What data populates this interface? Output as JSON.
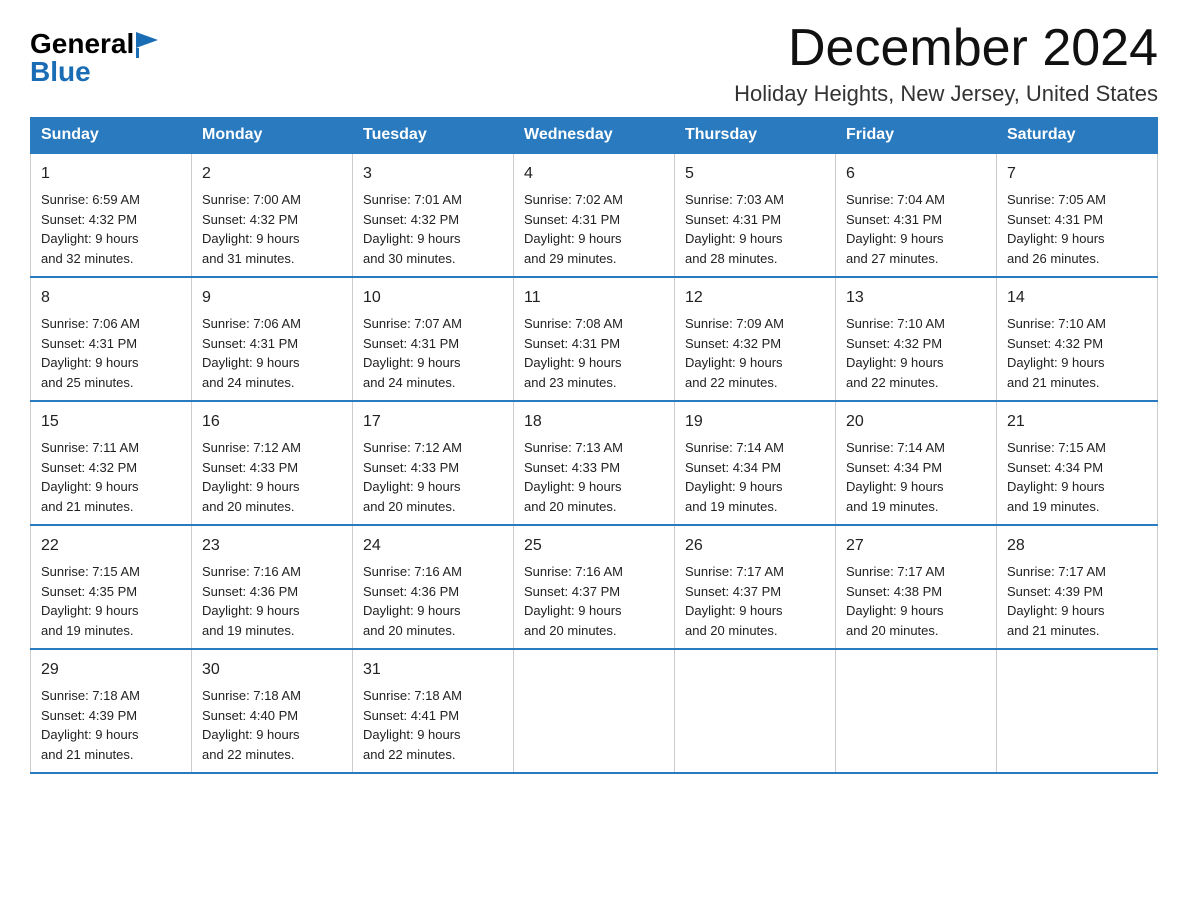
{
  "header": {
    "logo_general": "General",
    "logo_blue": "Blue",
    "month_title": "December 2024",
    "subtitle": "Holiday Heights, New Jersey, United States"
  },
  "weekdays": [
    "Sunday",
    "Monday",
    "Tuesday",
    "Wednesday",
    "Thursday",
    "Friday",
    "Saturday"
  ],
  "weeks": [
    [
      {
        "day": "1",
        "sunrise": "6:59 AM",
        "sunset": "4:32 PM",
        "daylight": "9 hours and 32 minutes."
      },
      {
        "day": "2",
        "sunrise": "7:00 AM",
        "sunset": "4:32 PM",
        "daylight": "9 hours and 31 minutes."
      },
      {
        "day": "3",
        "sunrise": "7:01 AM",
        "sunset": "4:32 PM",
        "daylight": "9 hours and 30 minutes."
      },
      {
        "day": "4",
        "sunrise": "7:02 AM",
        "sunset": "4:31 PM",
        "daylight": "9 hours and 29 minutes."
      },
      {
        "day": "5",
        "sunrise": "7:03 AM",
        "sunset": "4:31 PM",
        "daylight": "9 hours and 28 minutes."
      },
      {
        "day": "6",
        "sunrise": "7:04 AM",
        "sunset": "4:31 PM",
        "daylight": "9 hours and 27 minutes."
      },
      {
        "day": "7",
        "sunrise": "7:05 AM",
        "sunset": "4:31 PM",
        "daylight": "9 hours and 26 minutes."
      }
    ],
    [
      {
        "day": "8",
        "sunrise": "7:06 AM",
        "sunset": "4:31 PM",
        "daylight": "9 hours and 25 minutes."
      },
      {
        "day": "9",
        "sunrise": "7:06 AM",
        "sunset": "4:31 PM",
        "daylight": "9 hours and 24 minutes."
      },
      {
        "day": "10",
        "sunrise": "7:07 AM",
        "sunset": "4:31 PM",
        "daylight": "9 hours and 24 minutes."
      },
      {
        "day": "11",
        "sunrise": "7:08 AM",
        "sunset": "4:31 PM",
        "daylight": "9 hours and 23 minutes."
      },
      {
        "day": "12",
        "sunrise": "7:09 AM",
        "sunset": "4:32 PM",
        "daylight": "9 hours and 22 minutes."
      },
      {
        "day": "13",
        "sunrise": "7:10 AM",
        "sunset": "4:32 PM",
        "daylight": "9 hours and 22 minutes."
      },
      {
        "day": "14",
        "sunrise": "7:10 AM",
        "sunset": "4:32 PM",
        "daylight": "9 hours and 21 minutes."
      }
    ],
    [
      {
        "day": "15",
        "sunrise": "7:11 AM",
        "sunset": "4:32 PM",
        "daylight": "9 hours and 21 minutes."
      },
      {
        "day": "16",
        "sunrise": "7:12 AM",
        "sunset": "4:33 PM",
        "daylight": "9 hours and 20 minutes."
      },
      {
        "day": "17",
        "sunrise": "7:12 AM",
        "sunset": "4:33 PM",
        "daylight": "9 hours and 20 minutes."
      },
      {
        "day": "18",
        "sunrise": "7:13 AM",
        "sunset": "4:33 PM",
        "daylight": "9 hours and 20 minutes."
      },
      {
        "day": "19",
        "sunrise": "7:14 AM",
        "sunset": "4:34 PM",
        "daylight": "9 hours and 19 minutes."
      },
      {
        "day": "20",
        "sunrise": "7:14 AM",
        "sunset": "4:34 PM",
        "daylight": "9 hours and 19 minutes."
      },
      {
        "day": "21",
        "sunrise": "7:15 AM",
        "sunset": "4:34 PM",
        "daylight": "9 hours and 19 minutes."
      }
    ],
    [
      {
        "day": "22",
        "sunrise": "7:15 AM",
        "sunset": "4:35 PM",
        "daylight": "9 hours and 19 minutes."
      },
      {
        "day": "23",
        "sunrise": "7:16 AM",
        "sunset": "4:36 PM",
        "daylight": "9 hours and 19 minutes."
      },
      {
        "day": "24",
        "sunrise": "7:16 AM",
        "sunset": "4:36 PM",
        "daylight": "9 hours and 20 minutes."
      },
      {
        "day": "25",
        "sunrise": "7:16 AM",
        "sunset": "4:37 PM",
        "daylight": "9 hours and 20 minutes."
      },
      {
        "day": "26",
        "sunrise": "7:17 AM",
        "sunset": "4:37 PM",
        "daylight": "9 hours and 20 minutes."
      },
      {
        "day": "27",
        "sunrise": "7:17 AM",
        "sunset": "4:38 PM",
        "daylight": "9 hours and 20 minutes."
      },
      {
        "day": "28",
        "sunrise": "7:17 AM",
        "sunset": "4:39 PM",
        "daylight": "9 hours and 21 minutes."
      }
    ],
    [
      {
        "day": "29",
        "sunrise": "7:18 AM",
        "sunset": "4:39 PM",
        "daylight": "9 hours and 21 minutes."
      },
      {
        "day": "30",
        "sunrise": "7:18 AM",
        "sunset": "4:40 PM",
        "daylight": "9 hours and 22 minutes."
      },
      {
        "day": "31",
        "sunrise": "7:18 AM",
        "sunset": "4:41 PM",
        "daylight": "9 hours and 22 minutes."
      },
      null,
      null,
      null,
      null
    ]
  ],
  "labels": {
    "sunrise": "Sunrise:",
    "sunset": "Sunset:",
    "daylight": "Daylight:"
  }
}
